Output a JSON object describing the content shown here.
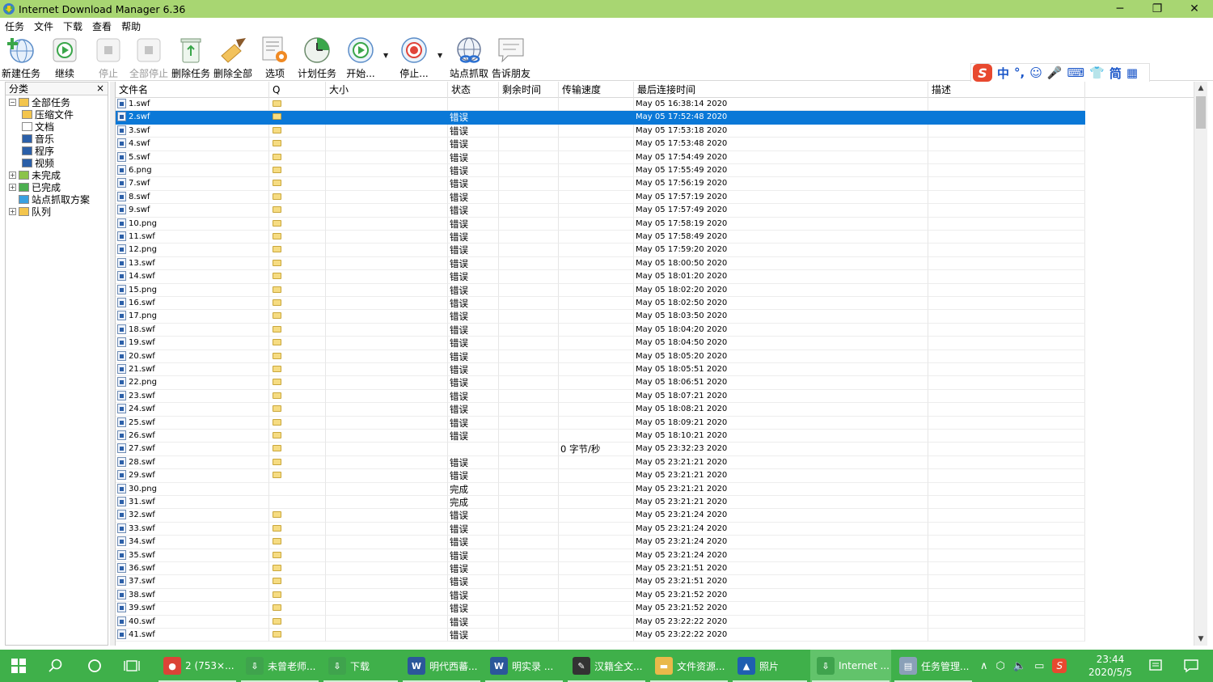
{
  "window": {
    "title": "Internet Download Manager 6.36",
    "controls": [
      "─",
      "❐",
      "✕"
    ]
  },
  "menu": [
    "任务",
    "文件",
    "下载",
    "查看",
    "帮助"
  ],
  "toolbar": {
    "new_task": "新建任务",
    "resume": "继续",
    "stop": "停止",
    "stop_all": "全部停止",
    "delete_task": "删除任务",
    "delete_all": "删除全部",
    "options": "选项",
    "scheduler": "计划任务",
    "start_queue": "开始...",
    "stop_queue": "停止...",
    "grabber": "站点抓取",
    "tell_friend": "告诉朋友"
  },
  "ime": {
    "logo": "S",
    "items": [
      "中",
      "°,",
      "☺",
      "🎤",
      "⌨",
      "👕",
      "简",
      "▦"
    ]
  },
  "categories": {
    "header": "分类",
    "close": "×",
    "items": [
      {
        "label": "全部任务",
        "level": 0,
        "exp": "−"
      },
      {
        "label": "压缩文件",
        "level": 1,
        "exp": ""
      },
      {
        "label": "文档",
        "level": 1,
        "exp": ""
      },
      {
        "label": "音乐",
        "level": 1,
        "exp": ""
      },
      {
        "label": "程序",
        "level": 1,
        "exp": ""
      },
      {
        "label": "视频",
        "level": 1,
        "exp": ""
      },
      {
        "label": "未完成",
        "level": 0,
        "exp": "+"
      },
      {
        "label": "已完成",
        "level": 0,
        "exp": "+"
      },
      {
        "label": "站点抓取方案",
        "level": 0,
        "exp": ""
      },
      {
        "label": "队列",
        "level": 0,
        "exp": "+"
      }
    ]
  },
  "columns": [
    "文件名",
    "Q",
    "大小",
    "状态",
    "剩余时间",
    "传输速度",
    "最后连接时间",
    "描述"
  ],
  "rows": [
    {
      "name": "1.swf",
      "q": true,
      "status": "",
      "speed": "",
      "time": "May 05 16:38:14 2020",
      "ext": "swf"
    },
    {
      "name": "2.swf",
      "q": true,
      "status": "错误",
      "speed": "",
      "time": "May 05 17:52:48 2020",
      "ext": "swf",
      "selected": true
    },
    {
      "name": "3.swf",
      "q": true,
      "status": "错误",
      "speed": "",
      "time": "May 05 17:53:18 2020",
      "ext": "swf"
    },
    {
      "name": "4.swf",
      "q": true,
      "status": "错误",
      "speed": "",
      "time": "May 05 17:53:48 2020",
      "ext": "swf"
    },
    {
      "name": "5.swf",
      "q": true,
      "status": "错误",
      "speed": "",
      "time": "May 05 17:54:49 2020",
      "ext": "swf"
    },
    {
      "name": "6.png",
      "q": true,
      "status": "错误",
      "speed": "",
      "time": "May 05 17:55:49 2020",
      "ext": "png"
    },
    {
      "name": "7.swf",
      "q": true,
      "status": "错误",
      "speed": "",
      "time": "May 05 17:56:19 2020",
      "ext": "swf"
    },
    {
      "name": "8.swf",
      "q": true,
      "status": "错误",
      "speed": "",
      "time": "May 05 17:57:19 2020",
      "ext": "swf"
    },
    {
      "name": "9.swf",
      "q": true,
      "status": "错误",
      "speed": "",
      "time": "May 05 17:57:49 2020",
      "ext": "swf"
    },
    {
      "name": "10.png",
      "q": true,
      "status": "错误",
      "speed": "",
      "time": "May 05 17:58:19 2020",
      "ext": "png"
    },
    {
      "name": "11.swf",
      "q": true,
      "status": "错误",
      "speed": "",
      "time": "May 05 17:58:49 2020",
      "ext": "swf"
    },
    {
      "name": "12.png",
      "q": true,
      "status": "错误",
      "speed": "",
      "time": "May 05 17:59:20 2020",
      "ext": "png"
    },
    {
      "name": "13.swf",
      "q": true,
      "status": "错误",
      "speed": "",
      "time": "May 05 18:00:50 2020",
      "ext": "swf"
    },
    {
      "name": "14.swf",
      "q": true,
      "status": "错误",
      "speed": "",
      "time": "May 05 18:01:20 2020",
      "ext": "swf"
    },
    {
      "name": "15.png",
      "q": true,
      "status": "错误",
      "speed": "",
      "time": "May 05 18:02:20 2020",
      "ext": "png"
    },
    {
      "name": "16.swf",
      "q": true,
      "status": "错误",
      "speed": "",
      "time": "May 05 18:02:50 2020",
      "ext": "swf"
    },
    {
      "name": "17.png",
      "q": true,
      "status": "错误",
      "speed": "",
      "time": "May 05 18:03:50 2020",
      "ext": "png"
    },
    {
      "name": "18.swf",
      "q": true,
      "status": "错误",
      "speed": "",
      "time": "May 05 18:04:20 2020",
      "ext": "swf"
    },
    {
      "name": "19.swf",
      "q": true,
      "status": "错误",
      "speed": "",
      "time": "May 05 18:04:50 2020",
      "ext": "swf"
    },
    {
      "name": "20.swf",
      "q": true,
      "status": "错误",
      "speed": "",
      "time": "May 05 18:05:20 2020",
      "ext": "swf"
    },
    {
      "name": "21.swf",
      "q": true,
      "status": "错误",
      "speed": "",
      "time": "May 05 18:05:51 2020",
      "ext": "swf"
    },
    {
      "name": "22.png",
      "q": true,
      "status": "错误",
      "speed": "",
      "time": "May 05 18:06:51 2020",
      "ext": "png"
    },
    {
      "name": "23.swf",
      "q": true,
      "status": "错误",
      "speed": "",
      "time": "May 05 18:07:21 2020",
      "ext": "swf"
    },
    {
      "name": "24.swf",
      "q": true,
      "status": "错误",
      "speed": "",
      "time": "May 05 18:08:21 2020",
      "ext": "swf"
    },
    {
      "name": "25.swf",
      "q": true,
      "status": "错误",
      "speed": "",
      "time": "May 05 18:09:21 2020",
      "ext": "swf"
    },
    {
      "name": "26.swf",
      "q": true,
      "status": "错误",
      "speed": "",
      "time": "May 05 18:10:21 2020",
      "ext": "swf"
    },
    {
      "name": "27.swf",
      "q": true,
      "status": "",
      "speed": "0 字节/秒",
      "time": "May 05 23:32:23 2020",
      "ext": "swf"
    },
    {
      "name": "28.swf",
      "q": true,
      "status": "错误",
      "speed": "",
      "time": "May 05 23:21:21 2020",
      "ext": "swf"
    },
    {
      "name": "29.swf",
      "q": true,
      "status": "错误",
      "speed": "",
      "time": "May 05 23:21:21 2020",
      "ext": "swf"
    },
    {
      "name": "30.png",
      "q": false,
      "status": "完成",
      "speed": "",
      "time": "May 05 23:21:21 2020",
      "ext": "png"
    },
    {
      "name": "31.swf",
      "q": false,
      "status": "完成",
      "speed": "",
      "time": "May 05 23:21:21 2020",
      "ext": "swf"
    },
    {
      "name": "32.swf",
      "q": true,
      "status": "错误",
      "speed": "",
      "time": "May 05 23:21:24 2020",
      "ext": "swf"
    },
    {
      "name": "33.swf",
      "q": true,
      "status": "错误",
      "speed": "",
      "time": "May 05 23:21:24 2020",
      "ext": "swf"
    },
    {
      "name": "34.swf",
      "q": true,
      "status": "错误",
      "speed": "",
      "time": "May 05 23:21:24 2020",
      "ext": "swf"
    },
    {
      "name": "35.swf",
      "q": true,
      "status": "错误",
      "speed": "",
      "time": "May 05 23:21:24 2020",
      "ext": "swf"
    },
    {
      "name": "36.swf",
      "q": true,
      "status": "错误",
      "speed": "",
      "time": "May 05 23:21:51 2020",
      "ext": "swf"
    },
    {
      "name": "37.swf",
      "q": true,
      "status": "错误",
      "speed": "",
      "time": "May 05 23:21:51 2020",
      "ext": "swf"
    },
    {
      "name": "38.swf",
      "q": true,
      "status": "错误",
      "speed": "",
      "time": "May 05 23:21:52 2020",
      "ext": "swf"
    },
    {
      "name": "39.swf",
      "q": true,
      "status": "错误",
      "speed": "",
      "time": "May 05 23:21:52 2020",
      "ext": "swf"
    },
    {
      "name": "40.swf",
      "q": true,
      "status": "错误",
      "speed": "",
      "time": "May 05 23:22:22 2020",
      "ext": "swf"
    },
    {
      "name": "41.swf",
      "q": true,
      "status": "错误",
      "speed": "",
      "time": "May 05 23:22:22 2020",
      "ext": "swf"
    }
  ],
  "scrollbar": {
    "up": "▲",
    "down": "▼"
  },
  "taskbar": {
    "apps": [
      {
        "label": "2 (753×...",
        "icon": "chrome-icon",
        "color": "#db4437",
        "glyph": "●"
      },
      {
        "label": "未曾老师...",
        "icon": "idm-icon",
        "color": "#3fa34d",
        "glyph": "⇩"
      },
      {
        "label": "下载",
        "icon": "idm-icon",
        "color": "#3fa34d",
        "glyph": "⇩"
      },
      {
        "label": "明代西蕃...",
        "icon": "word-icon",
        "color": "#2b579a",
        "glyph": "W"
      },
      {
        "label": "明实录 ...",
        "icon": "word-icon",
        "color": "#2b579a",
        "glyph": "W"
      },
      {
        "label": "汉籍全文...",
        "icon": "app-icon",
        "color": "#333333",
        "glyph": "✎"
      },
      {
        "label": "文件资源...",
        "icon": "folder-icon",
        "color": "#e9b94a",
        "glyph": "▬"
      },
      {
        "label": "照片",
        "icon": "photos-icon",
        "color": "#1f5fb0",
        "glyph": "▲"
      },
      {
        "label": "Internet ...",
        "icon": "idm-icon",
        "color": "#3fa34d",
        "glyph": "⇩",
        "active": true
      },
      {
        "label": "任务管理...",
        "icon": "taskmgr-icon",
        "color": "#8aa0b8",
        "glyph": "▤"
      }
    ],
    "clock_time": "23:44",
    "clock_date": "2020/5/5"
  },
  "colors": {
    "titlebar": "#a8d672",
    "taskbar": "#3fb04a",
    "selection": "#0a78d7"
  }
}
